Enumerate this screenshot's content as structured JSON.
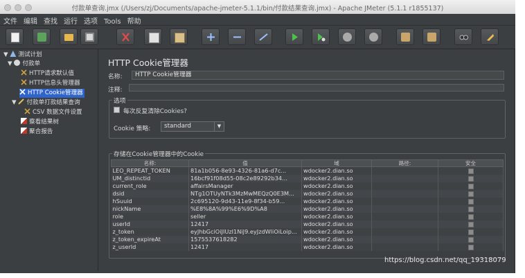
{
  "window": {
    "title": "付款单查询.jmx (/Users/zj/Documents/apache-jmeter-5.1.1/bin/付款结果查询.jmx) - Apache JMeter (5.1.1 r1855137)"
  },
  "menu": [
    "文件",
    "编辑",
    "查找",
    "运行",
    "选项",
    "Tools",
    "帮助"
  ],
  "toolbar": [
    "new-icon",
    "templates-icon",
    "open-icon",
    "save-icon",
    "cut-icon",
    "copy-icon",
    "paste-icon",
    "expand-icon",
    "collapse-icon",
    "toggle-icon",
    "start-icon",
    "start-no-pause-icon",
    "stop-icon",
    "shutdown-icon",
    "clear-icon",
    "clear-all-icon",
    "search-icon",
    "reset-search-icon"
  ],
  "tree": [
    {
      "label": "测试计划",
      "icon": "test-plan-icon",
      "arrow": "▼"
    },
    {
      "label": "付款单",
      "icon": "thread-group-icon",
      "arrow": "▼"
    },
    {
      "label": "HTTP请求默认值",
      "icon": "config-icon",
      "arrow": ""
    },
    {
      "label": "HTTP信息头管理器",
      "icon": "config-icon",
      "arrow": ""
    },
    {
      "label": "HTTP Cookie管理器",
      "icon": "config-icon",
      "arrow": ""
    },
    {
      "label": "付款单打款结果查询",
      "icon": "sampler-icon",
      "arrow": "▼"
    },
    {
      "label": "CSV 数据文件设置",
      "icon": "config-icon",
      "arrow": ""
    },
    {
      "label": "察看结果树",
      "icon": "listener-icon",
      "arrow": ""
    },
    {
      "label": "聚合报告",
      "icon": "listener-icon",
      "arrow": ""
    }
  ],
  "panel": {
    "title": "HTTP Cookie管理器",
    "name_label": "名称:",
    "name_value": "HTTP Cookie管理器",
    "comment_label": "注释:",
    "options_title": "选项",
    "clear_each_iteration": "每次反复清除Cookies?",
    "policy_label": "Cookie 策略:",
    "policy_value": "standard",
    "stored_title": "存储在Cookie管理器中的Cookie"
  },
  "cookies": {
    "columns": [
      "名称:",
      "值",
      "域",
      "路径:",
      "安全"
    ],
    "rows": [
      [
        "LEO_REPEAT_TOKEN",
        "81a1b056-8e93-4326-81a6-d7c...",
        "wdocker2.dian.so",
        ""
      ],
      [
        "UM_distinctid",
        "16bcf91f08d55-08c2e89292b34...",
        "wdocker2.dian.so",
        ""
      ],
      [
        "current_role",
        "affairsManager",
        "wdocker2.dian.so",
        ""
      ],
      [
        "dsid",
        "NTg1OTUyNTk3MzMwMEQzQ0E3M...",
        "wdocker2.dian.so",
        ""
      ],
      [
        "hSuuid",
        "2c695120-9d43-11e9-8f34-b59...",
        "wdocker2.dian.so",
        ""
      ],
      [
        "nickName",
        "%E8%8A%99%E6%9D%A8",
        "wdocker2.dian.so",
        ""
      ],
      [
        "role",
        "seller",
        "wdocker2.dian.so",
        ""
      ],
      [
        "userId",
        "12417",
        "wdocker2.dian.so",
        ""
      ],
      [
        "z_token",
        "eyJhbGciOiJIUzI1NiJ9.eyJzdWliOiLoip...",
        "wdocker2.dian.so",
        ""
      ],
      [
        "z_token_expireAt",
        "1575537618282",
        "wdocker2.dian.so",
        ""
      ],
      [
        "z_userId",
        "12417",
        "wdocker2.dian.so",
        ""
      ]
    ]
  },
  "watermark": "https://blog.csdn.net/qq_19318079"
}
